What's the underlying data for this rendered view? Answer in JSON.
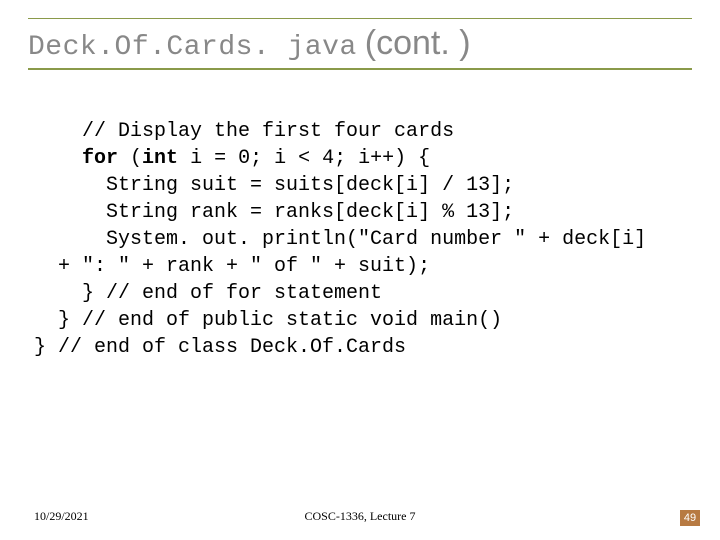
{
  "title": {
    "code_part": "Deck.Of.Cards. java",
    "cont_part": "(cont. )"
  },
  "code": {
    "line1": "    // Display the first four cards",
    "line2a": "    ",
    "line2_for": "for",
    "line2b": " (",
    "line2_int": "int",
    "line2c": " i = 0; i < 4; i++) {",
    "line3": "      String suit = suits[deck[i] / 13];",
    "line4": "      String rank = ranks[deck[i] % 13];",
    "line5": "      System. out. println(\"Card number \" + deck[i]",
    "line6": "  + \": \" + rank + \" of \" + suit);",
    "line7": "    } // end of for statement",
    "line8": "  } // end of public static void main()",
    "line9": "} // end of class Deck.Of.Cards"
  },
  "footer": {
    "date": "10/29/2021",
    "center": "COSC-1336, Lecture 7",
    "page": "49"
  }
}
